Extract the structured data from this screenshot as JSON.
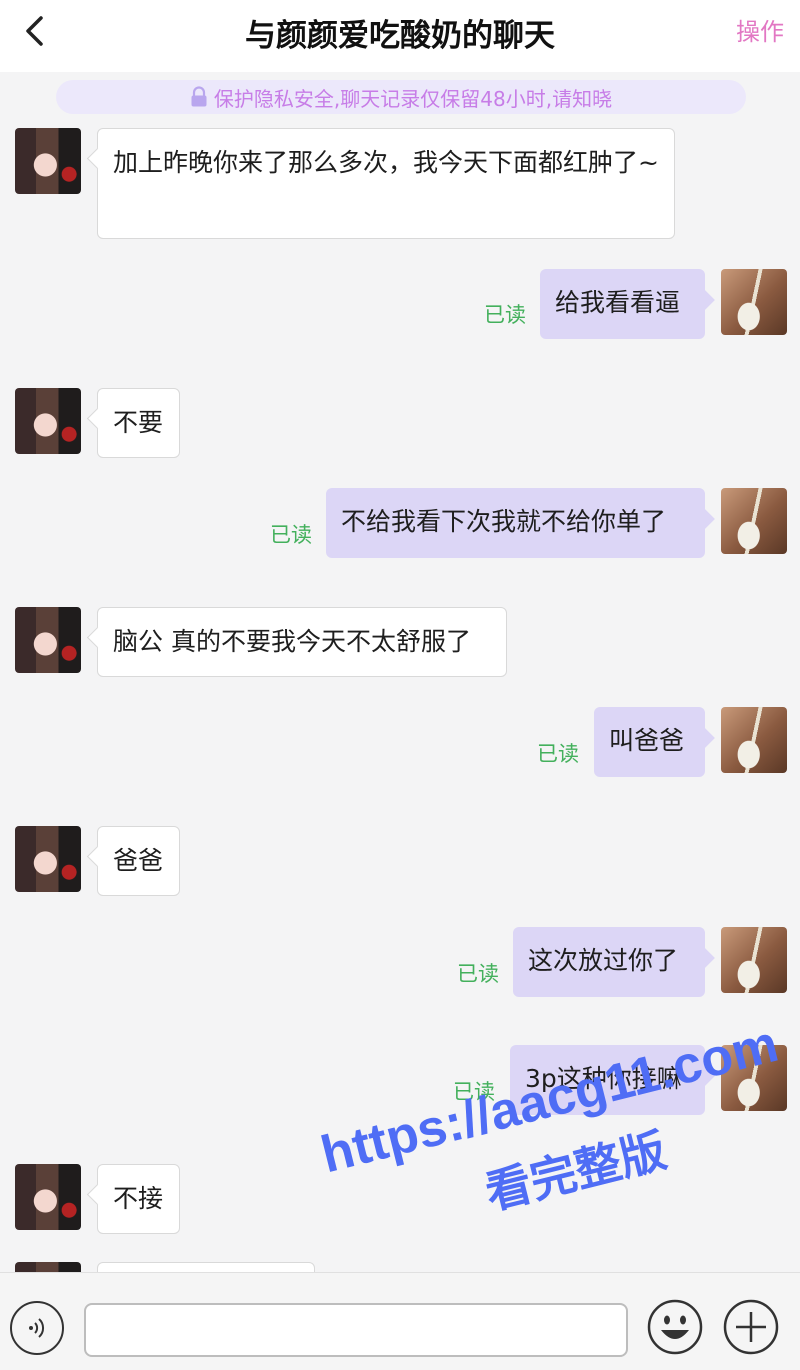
{
  "header": {
    "title": "与颜颜爱吃酸奶的聊天",
    "action": "操作"
  },
  "notice": {
    "text": "保护隐私安全,聊天记录仅保留48小时,请知晓"
  },
  "messages": [
    {
      "side": "left",
      "text": "加上昨晚你来了那么多次，我今天下面都红肿了~"
    },
    {
      "side": "right",
      "text": "给我看看逼",
      "status": "已读"
    },
    {
      "side": "left",
      "text": "不要"
    },
    {
      "side": "right",
      "text": "不给我看下次我就不给你单了",
      "status": "已读"
    },
    {
      "side": "left",
      "text": "脑公 真的不要我今天不太舒服了"
    },
    {
      "side": "right",
      "text": "叫爸爸",
      "status": "已读"
    },
    {
      "side": "left",
      "text": "爸爸"
    },
    {
      "side": "right",
      "text": "这次放过你了",
      "status": "已读"
    },
    {
      "side": "right",
      "text": "3p这种你接嘛",
      "status": "已读"
    },
    {
      "side": "left",
      "text": "不接"
    }
  ],
  "watermark": {
    "url": "https://aacg11.com",
    "cta": "看完整版"
  },
  "input_bar": {
    "value": "",
    "placeholder": ""
  },
  "icons": {
    "back": "back-chevron-icon",
    "lock": "lock-icon",
    "voice": "voice-icon",
    "emoji": "emoji-icon",
    "plus": "plus-icon"
  },
  "colors": {
    "action": "#e277c3",
    "notice_text": "#c77de7",
    "outgoing_bubble": "#dcd6f6",
    "read_status": "#43b05c",
    "watermark": "#4f6df5"
  }
}
